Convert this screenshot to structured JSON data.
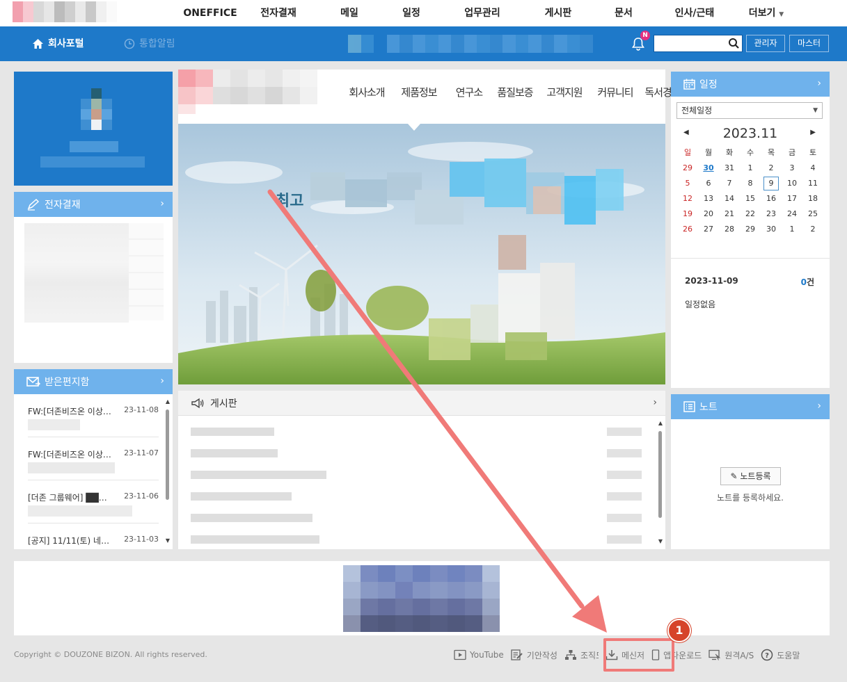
{
  "topnav": {
    "items": [
      "ONEFFICE",
      "전자결재",
      "메일",
      "일정",
      "업무관리",
      "게시판",
      "문서",
      "인사/근태",
      "더보기"
    ]
  },
  "bluebar": {
    "portal_tab": "회사포털",
    "alert_tab": "통합알림",
    "bell_badge": "N",
    "search_placeholder": "",
    "admin_button": "관리자",
    "master_button": "마스터"
  },
  "panels": {
    "approval_title": "전자결재",
    "mail_title": "받은편지함",
    "board_title": "게시판",
    "calendar_title": "일정",
    "note_title": "노트"
  },
  "mail": {
    "items": [
      {
        "subject": "FW:[더존비즈온 이상…",
        "date": "23-11-08"
      },
      {
        "subject": "FW:[더존비즈온 이상…",
        "date": "23-11-07"
      },
      {
        "subject": "[더존 그룹웨어] ██…",
        "date": "23-11-06"
      },
      {
        "subject": "[공지] 11/11(토) 네…",
        "date": "23-11-03"
      }
    ]
  },
  "company_nav": [
    "회사소개",
    "제품정보",
    "연구소",
    "품질보증",
    "고객지원",
    "커뮤니티",
    "독서경영"
  ],
  "calendar": {
    "filter": "전체일정",
    "month": "2023.11",
    "weekdays": [
      "일",
      "월",
      "화",
      "수",
      "목",
      "금",
      "토"
    ],
    "weeks": [
      [
        "29",
        "30",
        "31",
        "1",
        "2",
        "3",
        "4"
      ],
      [
        "5",
        "6",
        "7",
        "8",
        "9",
        "10",
        "11"
      ],
      [
        "12",
        "13",
        "14",
        "15",
        "16",
        "17",
        "18"
      ],
      [
        "19",
        "20",
        "21",
        "22",
        "23",
        "24",
        "25"
      ],
      [
        "26",
        "27",
        "28",
        "29",
        "30",
        "1",
        "2"
      ]
    ],
    "selected_date": "2023-11-09",
    "count": "0",
    "count_unit": "건",
    "empty_text": "일정없음"
  },
  "note": {
    "button": "노트등록",
    "message": "노트를 등록하세요."
  },
  "footer": {
    "copyright": "Copyright © DOUZONE BIZON. All rights reserved.",
    "links": [
      "YouTube",
      "기안작성",
      "조직도",
      "메신저",
      "앱다운로드",
      "원격A/S",
      "도움말"
    ]
  },
  "annotation": {
    "step": "1",
    "color": "#f07a78"
  }
}
